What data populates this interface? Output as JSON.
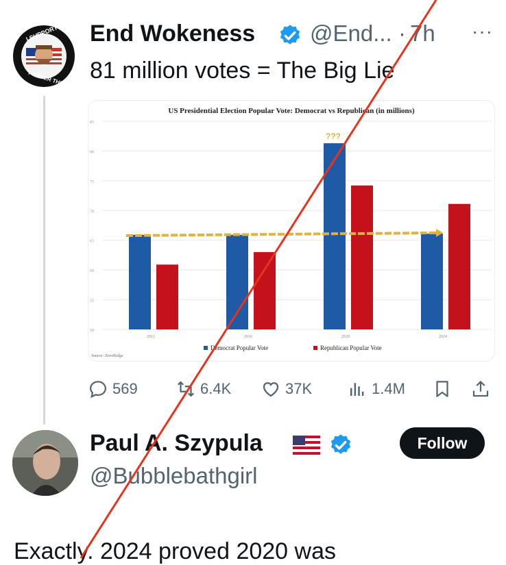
{
  "tweet": {
    "author_name": "End Wokeness",
    "handle": "@End...",
    "separator": "·",
    "time": "7h",
    "more": "···",
    "text": "81 million votes = The Big Lie",
    "avatar_badge_text": "I SUPPORT THE FORMER THING",
    "avatar_badge_top": "I SUPPORT THE",
    "avatar_badge_bottom": "FORMER THINGS"
  },
  "chart_data": {
    "type": "bar",
    "title": "US Presidential Election Popular Vote: Democrat vs Republican (in millions)",
    "categories": [
      "2012",
      "2016",
      "2020",
      "2024"
    ],
    "series": [
      {
        "name": "Democrat Popular Vote",
        "values": [
          65.9,
          65.9,
          81.3,
          66.1
        ],
        "color": "#1f5aa6"
      },
      {
        "name": "Republican Popular Vote",
        "values": [
          60.9,
          63.0,
          74.2,
          71.1
        ],
        "color": "#c4121c"
      }
    ],
    "ylim": [
      50,
      85
    ],
    "yticks": [
      "85",
      "80",
      "75",
      "70",
      "65",
      "60",
      "55",
      "50"
    ],
    "reference_line": {
      "value": 66,
      "color": "#e2b33a",
      "style": "dashed"
    },
    "annotation": "???",
    "source": "Source: ZeroHedge",
    "legend_position": "bottom",
    "grid": true
  },
  "actions": {
    "replies": "569",
    "reposts": "6.4K",
    "likes": "37K",
    "views": "1.4M"
  },
  "reply": {
    "author_name": "Paul A. Szypula",
    "handle": "@Bubblebathgirl",
    "follow_label": "Follow",
    "text": "Exactly. 2024 proved 2020 was"
  },
  "colors": {
    "verified": "#1d9bf0",
    "overlay_line": "#e8321c",
    "text_secondary": "#536471"
  }
}
